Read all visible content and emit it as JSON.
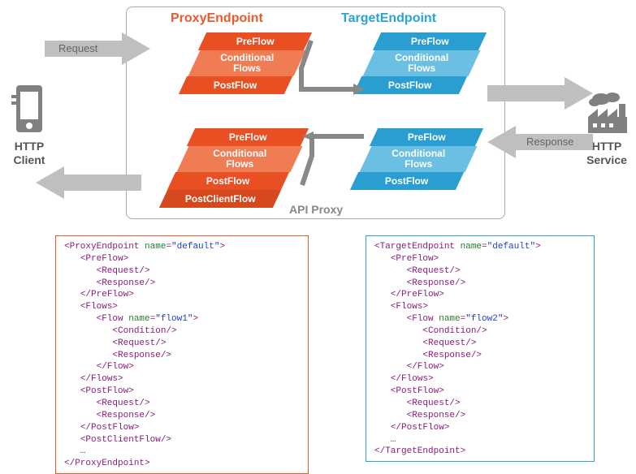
{
  "header": {
    "proxy_title": "ProxyEndpoint",
    "target_title": "TargetEndpoint",
    "api_proxy_label": "API Proxy"
  },
  "arrows": {
    "request": "Request",
    "response": "Response"
  },
  "sides": {
    "client": "HTTP\nClient",
    "service": "HTTP\nService"
  },
  "stacks": {
    "preflow": "PreFlow",
    "cond": "Conditional\nFlows",
    "postflow": "PostFlow",
    "postclient": "PostClientFlow"
  },
  "xml_proxy": {
    "open": "<ProxyEndpoint name=\"default\">",
    "preflow_open": "<PreFlow>",
    "request": "<Request/>",
    "response": "<Response/>",
    "preflow_close": "</PreFlow>",
    "flows_open": "<Flows>",
    "flow_open": "<Flow name=\"flow1\">",
    "condition": "<Condition/>",
    "flow_close": "</Flow>",
    "flows_close": "</Flows>",
    "postflow_open": "<PostFlow>",
    "postflow_close": "</PostFlow>",
    "postclient": "<PostClientFlow/>",
    "ellipsis": "…",
    "close": "</ProxyEndpoint>"
  },
  "xml_target": {
    "open": "<TargetEndpoint name=\"default\">",
    "preflow_open": "<PreFlow>",
    "request": "<Request/>",
    "response": "<Response/>",
    "preflow_close": "</PreFlow>",
    "flows_open": "<Flows>",
    "flow_open": "<Flow name=\"flow2\">",
    "condition": "<Condition/>",
    "flow_close": "</Flow>",
    "flows_close": "</Flows>",
    "postflow_open": "<PostFlow>",
    "postflow_close": "</PostFlow>",
    "ellipsis": "…",
    "close": "</TargetEndpoint>"
  }
}
